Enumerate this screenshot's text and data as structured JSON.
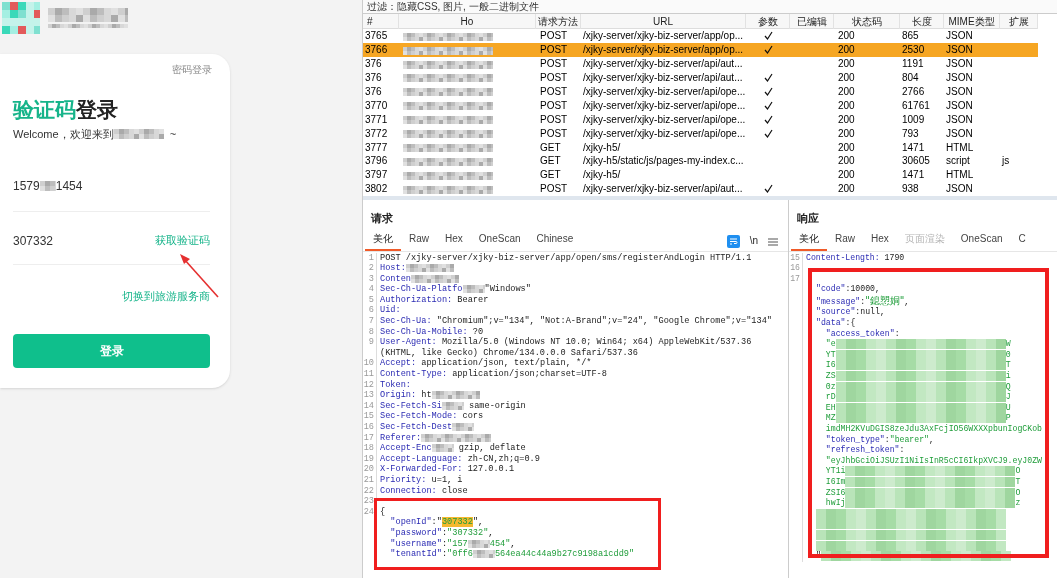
{
  "login": {
    "password_login_tab": "密码登录",
    "title_highlight": "验证码",
    "title_rest": "登录",
    "welcome_prefix": "Welcome，欢迎来到",
    "welcome_suffix": "~",
    "phone_prefix": "1579",
    "phone_suffix": "1454",
    "code_value": "307332",
    "get_code_link": "获取验证码",
    "switch_link": "切换到旅游服务商",
    "login_button": "登录"
  },
  "filter_bar": "过滤：隐藏CSS, 图片, 一般二进制文件",
  "table": {
    "columns": [
      "#",
      "Ho",
      "请求方法",
      "URL",
      "参数",
      "已编辑",
      "状态码",
      "长度",
      "MIME类型",
      "扩展"
    ],
    "rows": [
      {
        "num": "3765",
        "method": "POST",
        "url": "/xjky-server/xjky-biz-server/app/op...",
        "params": true,
        "status": "200",
        "length": "865",
        "mime": "JSON",
        "selected": false
      },
      {
        "num": "3766",
        "method": "POST",
        "url": "/xjky-server/xjky-biz-server/app/op...",
        "params": true,
        "status": "200",
        "length": "2530",
        "mime": "JSON",
        "selected": true
      },
      {
        "num": "376",
        "method": "POST",
        "url": "/xjky-server/xjky-biz-server/api/aut...",
        "params": false,
        "status": "200",
        "length": "1191",
        "mime": "JSON",
        "selected": false
      },
      {
        "num": "376",
        "method": "POST",
        "url": "/xjky-server/xjky-biz-server/api/aut...",
        "params": true,
        "status": "200",
        "length": "804",
        "mime": "JSON",
        "selected": false
      },
      {
        "num": "376",
        "method": "POST",
        "url": "/xjky-server/xjky-biz-server/api/ope...",
        "params": true,
        "status": "200",
        "length": "2766",
        "mime": "JSON",
        "selected": false
      },
      {
        "num": "3770",
        "method": "POST",
        "url": "/xjky-server/xjky-biz-server/api/ope...",
        "params": true,
        "status": "200",
        "length": "61761",
        "mime": "JSON",
        "selected": false
      },
      {
        "num": "3771",
        "method": "POST",
        "url": "/xjky-server/xjky-biz-server/api/ope...",
        "params": true,
        "status": "200",
        "length": "1009",
        "mime": "JSON",
        "selected": false
      },
      {
        "num": "3772",
        "method": "POST",
        "url": "/xjky-server/xjky-biz-server/api/ope...",
        "params": true,
        "status": "200",
        "length": "793",
        "mime": "JSON",
        "selected": false
      },
      {
        "num": "3777",
        "method": "GET",
        "url": "/xjky-h5/",
        "params": false,
        "status": "200",
        "length": "1471",
        "mime": "HTML",
        "selected": false
      },
      {
        "num": "3796",
        "method": "GET",
        "url": "/xjky-h5/static/js/pages-my-index.c...",
        "params": false,
        "status": "200",
        "length": "30605",
        "mime": "script",
        "ext": "js",
        "selected": false
      },
      {
        "num": "3797",
        "method": "GET",
        "url": "/xjky-h5/",
        "params": false,
        "status": "200",
        "length": "1471",
        "mime": "HTML",
        "selected": false
      },
      {
        "num": "3802",
        "method": "POST",
        "url": "/xjky-server/xjky-biz-server/api/aut...",
        "params": true,
        "status": "200",
        "length": "938",
        "mime": "JSON",
        "selected": false
      }
    ]
  },
  "request": {
    "title": "请求",
    "tabs": [
      {
        "label": "美化",
        "selected": true,
        "disabled": false
      },
      {
        "label": "Raw",
        "selected": false,
        "disabled": false
      },
      {
        "label": "Hex",
        "selected": false,
        "disabled": false
      },
      {
        "label": "OneScan",
        "selected": false,
        "disabled": false
      },
      {
        "label": "Chinese",
        "selected": false,
        "disabled": false
      }
    ],
    "newline_toggle": "\\n",
    "lines": [
      {
        "n": "1",
        "segs": [
          {
            "kind": "plain",
            "s": "POST /xjky-server/xjky-biz-server/app/open/sms/registerAndLogin HTTP/1.1"
          }
        ]
      },
      {
        "n": "2",
        "segs": [
          {
            "kind": "key",
            "s": "Host:"
          },
          {
            "kind": "blur_m"
          }
        ]
      },
      {
        "n": "3",
        "segs": [
          {
            "kind": "key",
            "s": "Conten"
          },
          {
            "kind": "blur_m"
          }
        ]
      },
      {
        "n": "4",
        "segs": [
          {
            "kind": "key",
            "s": "Sec-Ch-Ua-Platfo"
          },
          {
            "kind": "blur_s"
          },
          {
            "kind": "plain",
            "s": "\"Windows\""
          }
        ]
      },
      {
        "n": "5",
        "segs": [
          {
            "kind": "key",
            "s": "Authorization:"
          },
          {
            "kind": "plain",
            "s": " Bearer"
          }
        ]
      },
      {
        "n": "6",
        "segs": [
          {
            "kind": "key",
            "s": "Uid:"
          }
        ]
      },
      {
        "n": "7",
        "segs": [
          {
            "kind": "key",
            "s": "Sec-Ch-Ua:"
          },
          {
            "kind": "plain",
            "s": " \"Chromium\";v=\"134\", \"Not:A-Brand\";v=\"24\", \"Google Chrome\";v=\"134\""
          }
        ]
      },
      {
        "n": "8",
        "segs": [
          {
            "kind": "key",
            "s": "Sec-Ch-Ua-Mobile:"
          },
          {
            "kind": "plain",
            "s": " ?0"
          }
        ]
      },
      {
        "n": "9",
        "segs": [
          {
            "kind": "key",
            "s": "User-Agent:"
          },
          {
            "kind": "plain",
            "s": " Mozilla/5.0 (Windows NT 10.0; Win64; x64) AppleWebKit/537.36 (KHTML, like Gecko) Chrome/134.0.0.0 Safari/537.36"
          }
        ]
      },
      {
        "n": "10",
        "segs": [
          {
            "kind": "key",
            "s": "Accept:"
          },
          {
            "kind": "plain",
            "s": " application/json, text/plain, */*"
          }
        ]
      },
      {
        "n": "11",
        "segs": [
          {
            "kind": "key",
            "s": "Content-Type:"
          },
          {
            "kind": "plain",
            "s": " application/json;charset=UTF-8"
          }
        ]
      },
      {
        "n": "12",
        "segs": [
          {
            "kind": "key",
            "s": "Token:"
          }
        ]
      },
      {
        "n": "13",
        "segs": [
          {
            "kind": "key",
            "s": "Origin:"
          },
          {
            "kind": "plain",
            "s": " ht"
          },
          {
            "kind": "blur_m"
          }
        ]
      },
      {
        "n": "14",
        "segs": [
          {
            "kind": "key",
            "s": "Sec-Fetch-Si"
          },
          {
            "kind": "blur_s"
          },
          {
            "kind": "plain",
            "s": " same-origin"
          }
        ]
      },
      {
        "n": "15",
        "segs": [
          {
            "kind": "key",
            "s": "Sec-Fetch-Mode:"
          },
          {
            "kind": "plain",
            "s": " cors"
          }
        ]
      },
      {
        "n": "16",
        "segs": [
          {
            "kind": "key",
            "s": "Sec-Fetch-Dest"
          },
          {
            "kind": "blur_s"
          }
        ]
      },
      {
        "n": "17",
        "segs": [
          {
            "kind": "key",
            "s": "Referer:"
          },
          {
            "kind": "blur_l"
          }
        ]
      },
      {
        "n": "18",
        "segs": [
          {
            "kind": "key",
            "s": "Accept-Enc"
          },
          {
            "kind": "blur_s"
          },
          {
            "kind": "plain",
            "s": " gzip, deflate"
          }
        ]
      },
      {
        "n": "19",
        "segs": [
          {
            "kind": "key",
            "s": "Accept-Language:"
          },
          {
            "kind": "plain",
            "s": " zh-CN,zh;q=0.9"
          }
        ]
      },
      {
        "n": "20",
        "segs": [
          {
            "kind": "key",
            "s": "X-Forwarded-For:"
          },
          {
            "kind": "plain",
            "s": " 127.0.0.1"
          }
        ]
      },
      {
        "n": "21",
        "segs": [
          {
            "kind": "key",
            "s": "Priority:"
          },
          {
            "kind": "plain",
            "s": " u=1, i"
          }
        ]
      },
      {
        "n": "22",
        "segs": [
          {
            "kind": "key",
            "s": "Connection:"
          },
          {
            "kind": "plain",
            "s": " close"
          }
        ]
      },
      {
        "n": "23"
      },
      {
        "n": "24",
        "segs": [
          {
            "kind": "plain",
            "s": "{"
          }
        ]
      },
      {
        "segs": [
          {
            "kind": "key",
            "s": "  \"openId\""
          },
          {
            "kind": "plain",
            "s": ":\""
          },
          {
            "kind": "hl",
            "s": "307332"
          },
          {
            "kind": "plain",
            "s": "\","
          }
        ]
      },
      {
        "segs": [
          {
            "kind": "key",
            "s": "  \"password\""
          },
          {
            "kind": "plain",
            "s": ":"
          },
          {
            "kind": "str",
            "s": "\"307332\""
          },
          {
            "kind": "plain",
            "s": ","
          }
        ]
      },
      {
        "segs": [
          {
            "kind": "key",
            "s": "  \"username\""
          },
          {
            "kind": "plain",
            "s": ":"
          },
          {
            "kind": "str",
            "s": "\"157"
          },
          {
            "kind": "blur_s"
          },
          {
            "kind": "str",
            "s": "454\""
          },
          {
            "kind": "plain",
            "s": ","
          }
        ]
      },
      {
        "segs": [
          {
            "kind": "key",
            "s": "  \"tenantId\""
          },
          {
            "kind": "plain",
            "s": ":"
          },
          {
            "kind": "str",
            "s": "\"0ff6"
          },
          {
            "kind": "blur_s"
          },
          {
            "kind": "str",
            "s": "564ea44c44a9b27c9198a1cdd9\""
          }
        ]
      }
    ]
  },
  "response": {
    "title": "响应",
    "tabs": [
      {
        "label": "美化",
        "selected": true,
        "disabled": false
      },
      {
        "label": "Raw",
        "selected": false,
        "disabled": false
      },
      {
        "label": "Hex",
        "selected": false,
        "disabled": false
      },
      {
        "label": "页面渲染",
        "selected": false,
        "disabled": true
      },
      {
        "label": "OneScan",
        "selected": false,
        "disabled": false
      },
      {
        "label": "C",
        "selected": false,
        "disabled": false
      }
    ],
    "lines": [
      {
        "n": "15",
        "segs": [
          {
            "kind": "key",
            "s": "Content-Length:"
          },
          {
            "kind": "plain",
            "s": " 1790"
          }
        ]
      },
      {
        "n": "16"
      },
      {
        "n": "17"
      },
      {
        "segs": [
          {
            "kind": "key",
            "s": "\"code\""
          },
          {
            "kind": "plain",
            "s": ":10000,"
          }
        ]
      },
      {
        "segs": [
          {
            "kind": "key",
            "s": "\"message\""
          },
          {
            "kind": "plain",
            "s": ":"
          },
          {
            "kind": "str_cjk",
            "s": "\"鎴愬姛\""
          },
          {
            "kind": "plain",
            "s": ","
          }
        ]
      },
      {
        "segs": [
          {
            "kind": "key",
            "s": "\"source\""
          },
          {
            "kind": "plain",
            "s": ":null,"
          }
        ]
      },
      {
        "segs": [
          {
            "kind": "key",
            "s": "\"data\""
          },
          {
            "kind": "plain",
            "s": ":{"
          }
        ]
      },
      {
        "segs": [
          {
            "kind": "key",
            "s": "  \"access_token\""
          },
          {
            "kind": "plain",
            "s": ":"
          }
        ]
      },
      {
        "segs": [
          {
            "kind": "str",
            "s": "  \"e"
          },
          {
            "kind": "blur_g"
          },
          {
            "kind": "str",
            "s": "W"
          }
        ]
      },
      {
        "segs": [
          {
            "kind": "str",
            "s": "  YT"
          },
          {
            "kind": "blur_g"
          },
          {
            "kind": "str",
            "s": "0"
          }
        ]
      },
      {
        "segs": [
          {
            "kind": "str",
            "s": "  I6"
          },
          {
            "kind": "blur_g"
          },
          {
            "kind": "str",
            "s": "T"
          }
        ]
      },
      {
        "segs": [
          {
            "kind": "str",
            "s": "  ZS"
          },
          {
            "kind": "blur_g"
          },
          {
            "kind": "str",
            "s": "i"
          }
        ]
      },
      {
        "segs": [
          {
            "kind": "str",
            "s": "  0z"
          },
          {
            "kind": "blur_g"
          },
          {
            "kind": "str",
            "s": "Q"
          }
        ]
      },
      {
        "segs": [
          {
            "kind": "str",
            "s": "  rD"
          },
          {
            "kind": "blur_g"
          },
          {
            "kind": "str",
            "s": "J"
          }
        ]
      },
      {
        "segs": [
          {
            "kind": "str",
            "s": "  EH"
          },
          {
            "kind": "blur_g"
          },
          {
            "kind": "str",
            "s": "U"
          }
        ]
      },
      {
        "segs": [
          {
            "kind": "str",
            "s": "  MZ"
          },
          {
            "kind": "blur_g"
          },
          {
            "kind": "str",
            "s": "P"
          }
        ]
      },
      {
        "segs": [
          {
            "kind": "str",
            "s": "  imdMH2KVuDGIS8zeJdu3AxFcjIO56WXXXpbunIogCKob"
          }
        ]
      },
      {
        "segs": [
          {
            "kind": "key",
            "s": "  \"token_type\""
          },
          {
            "kind": "plain",
            "s": ":"
          },
          {
            "kind": "str",
            "s": "\"bearer\""
          },
          {
            "kind": "plain",
            "s": ","
          }
        ]
      },
      {
        "segs": [
          {
            "kind": "key",
            "s": "  \"refresh_token\""
          },
          {
            "kind": "plain",
            "s": ":"
          }
        ]
      },
      {
        "segs": [
          {
            "kind": "str",
            "s": "  \"eyJhbGciOiJSUzI1NiIsInR5cCI6IkpXVCJ9.eyJ0ZW"
          }
        ]
      },
      {
        "segs": [
          {
            "kind": "str",
            "s": "  YT1i"
          },
          {
            "kind": "blur_g"
          },
          {
            "kind": "str",
            "s": "O"
          }
        ]
      },
      {
        "segs": [
          {
            "kind": "str",
            "s": "  I6Im"
          },
          {
            "kind": "blur_g"
          },
          {
            "kind": "str",
            "s": "T"
          }
        ]
      },
      {
        "segs": [
          {
            "kind": "str",
            "s": "  ZSI6"
          },
          {
            "kind": "blur_g"
          },
          {
            "kind": "str",
            "s": "O"
          }
        ]
      },
      {
        "segs": [
          {
            "kind": "str",
            "s": "  hwIj"
          },
          {
            "kind": "blur_g"
          },
          {
            "kind": "str",
            "s": "z"
          }
        ]
      },
      {
        "segs": [
          {
            "kind": "blur_w"
          }
        ]
      },
      {
        "segs": [
          {
            "kind": "blur_w"
          }
        ]
      },
      {
        "segs": [
          {
            "kind": "blur_w"
          }
        ]
      },
      {
        "segs": [
          {
            "kind": "blur_w"
          }
        ]
      },
      {
        "segs": [
          {
            "kind": "plain",
            "s": "\""
          },
          {
            "kind": "blur_w"
          }
        ]
      }
    ]
  }
}
